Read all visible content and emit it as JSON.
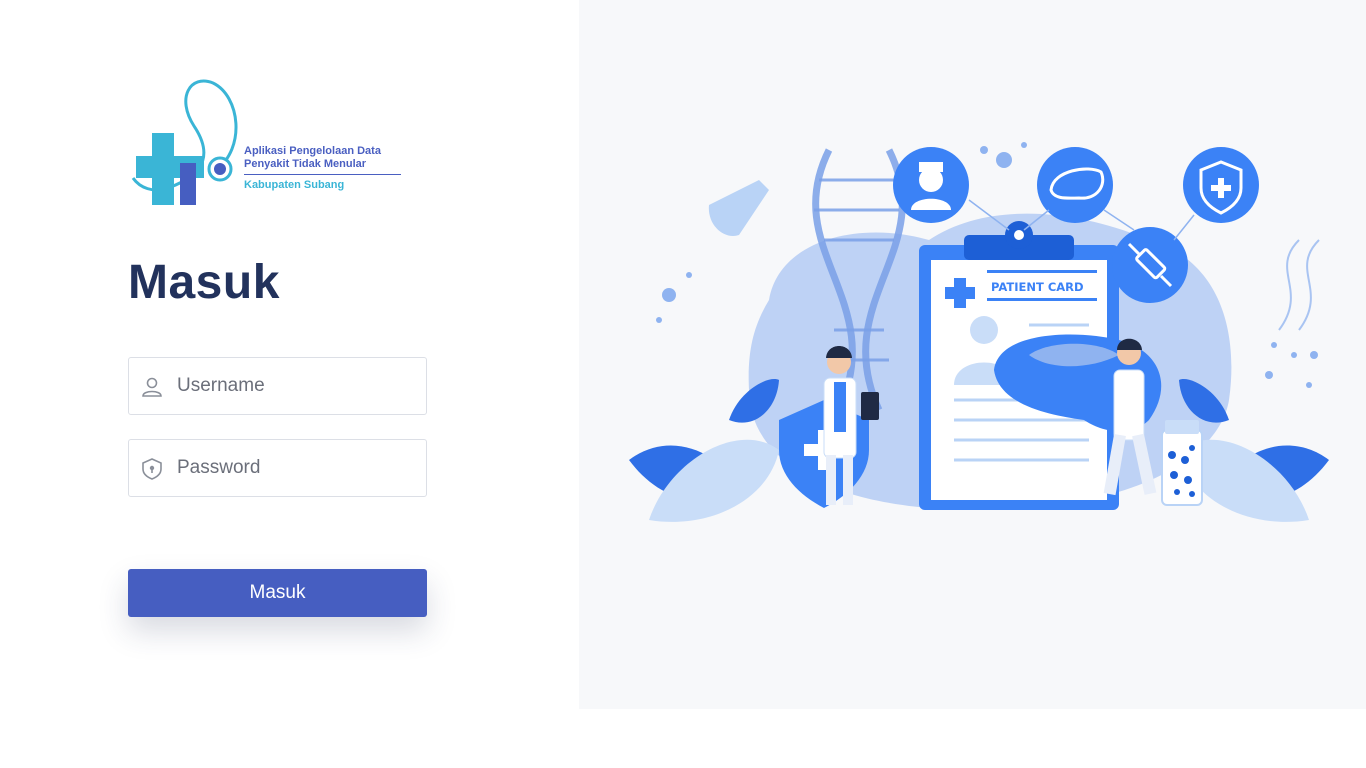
{
  "logo": {
    "line1": "Aplikasi Pengelolaan Data",
    "line2": "Penyakit Tidak Menular",
    "line3": "Kabupaten Subang"
  },
  "heading": "Masuk",
  "form": {
    "username_placeholder": "Username",
    "password_placeholder": "Password",
    "submit_label": "Masuk"
  },
  "illustration": {
    "card_title": "PATIENT CARD"
  },
  "colors": {
    "primary": "#465ec1",
    "heading": "#22325c",
    "logo_cyan": "#3ab5d6",
    "illustration_blue": "#3b82f6",
    "panel_bg": "#f7f8fa"
  },
  "icons": [
    "user-icon",
    "lock-icon",
    "nurse-icon",
    "liver-icon",
    "syringe-icon",
    "shield-plus-icon",
    "dna-icon",
    "flask-icon"
  ]
}
